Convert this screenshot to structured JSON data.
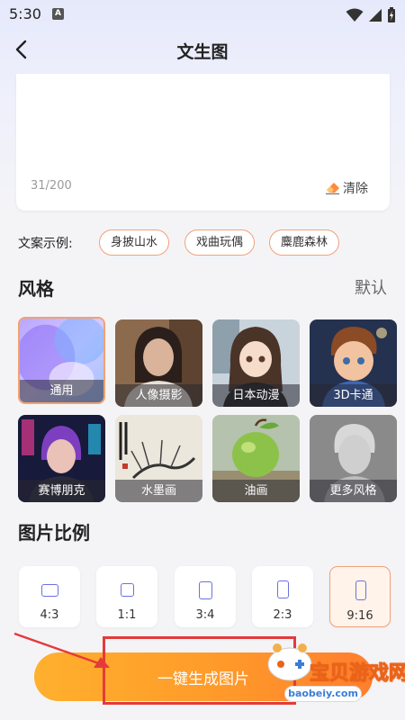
{
  "status_bar": {
    "time": "5:30",
    "notification_badge": "A"
  },
  "header": {
    "title": "文生图"
  },
  "prompt_card": {
    "char_count": "31/200",
    "clear_label": "清除"
  },
  "examples": {
    "label": "文案示例:",
    "tags": [
      "身披山水",
      "戏曲玩偶",
      "麋鹿森林"
    ]
  },
  "style_section": {
    "title": "风格",
    "default_label": "默认",
    "styles": [
      {
        "label": "通用",
        "selected": true
      },
      {
        "label": "人像摄影",
        "selected": false
      },
      {
        "label": "日本动漫",
        "selected": false
      },
      {
        "label": "3D卡通",
        "selected": false
      },
      {
        "label": "赛博朋克",
        "selected": false
      },
      {
        "label": "水墨画",
        "selected": false
      },
      {
        "label": "油画",
        "selected": false
      },
      {
        "label": "更多风格",
        "selected": false
      }
    ]
  },
  "ratio_section": {
    "title": "图片比例",
    "ratios": [
      {
        "label": "4:3",
        "selected": false
      },
      {
        "label": "1:1",
        "selected": false
      },
      {
        "label": "3:4",
        "selected": false
      },
      {
        "label": "2:3",
        "selected": false
      },
      {
        "label": "9:16",
        "selected": true
      }
    ]
  },
  "generate_button": {
    "label": "一键生成图片"
  },
  "watermark": {
    "text": "宝贝游戏网",
    "url": "baobeiy.com"
  },
  "colors": {
    "accent": "#f3a170",
    "button_start": "#ffb02d",
    "button_end": "#ff7e2e",
    "ratio_icon": "#6c71e0",
    "annotation_red": "#e53a3a"
  }
}
